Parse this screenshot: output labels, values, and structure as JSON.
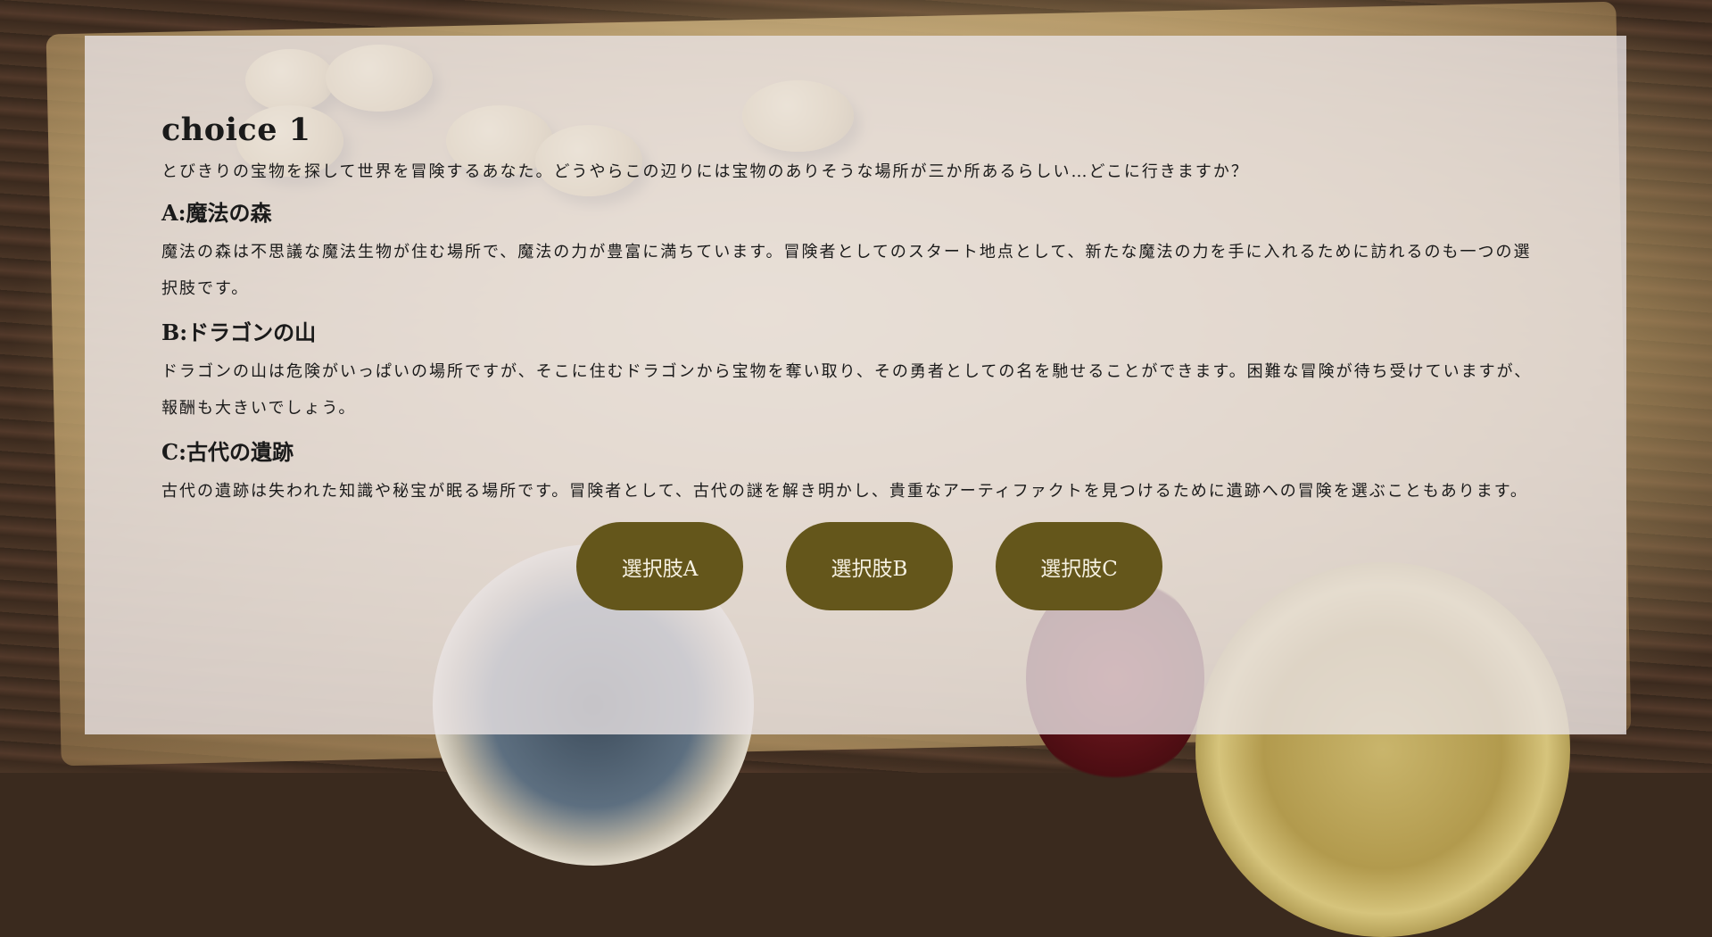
{
  "page": {
    "title": "choice 1",
    "intro": "とびきりの宝物を探して世界を冒険するあなた。どうやらこの辺りには宝物のありそうな場所が三か所あるらしい…どこに行きますか？"
  },
  "options": [
    {
      "heading": "A:魔法の森",
      "text": "魔法の森は不思議な魔法生物が住む場所で、魔法の力が豊富に満ちています。冒険者としてのスタート地点として、新たな魔法の力を手に入れるために訪れるのも一つの選択肢です。"
    },
    {
      "heading": "B:ドラゴンの山",
      "text": "ドラゴンの山は危険がいっぱいの場所ですが、そこに住むドラゴンから宝物を奪い取り、その勇者としての名を馳せることができます。困難な冒険が待ち受けていますが、報酬も大きいでしょう。"
    },
    {
      "heading": "C:古代の遺跡",
      "text": "古代の遺跡は失われた知識や秘宝が眠る場所です。冒険者として、古代の謎を解き明かし、貴重なアーティファクトを見つけるために遺跡への冒険を選ぶこともあります。"
    }
  ],
  "buttons": {
    "a_label": "選択肢A",
    "b_label": "選択肢B",
    "c_label": "選択肢C"
  },
  "colors": {
    "button_bg": "#64561b",
    "button_text": "#f6f1e2",
    "panel_bg": "rgba(232,226,228,0.80)"
  }
}
